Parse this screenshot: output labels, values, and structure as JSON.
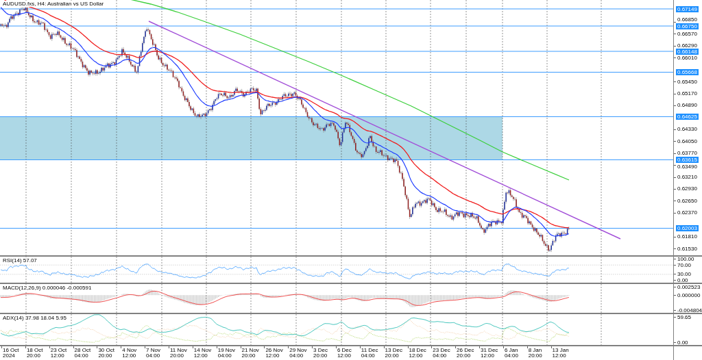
{
  "chart": {
    "title": "AUDUSD.fxs, H4: Australian vs US Dollar",
    "price_ticks": [
      "0.66850",
      "0.66570",
      "0.66290",
      "0.66010",
      "0.65450",
      "0.65170",
      "0.64890",
      "0.64330",
      "0.64050",
      "0.63770",
      "0.63490",
      "0.63210",
      "0.62930",
      "0.62650",
      "0.62370",
      "0.61810",
      "0.61530"
    ],
    "price_levels": [
      "0.67149",
      "0.66750",
      "0.66148",
      "0.65668",
      "0.64625",
      "0.63615",
      "0.62003"
    ]
  },
  "indicators": [
    {
      "kind": "rsi",
      "title": "RSI(14) 57.07",
      "ticks": [
        "100.00",
        "70.00",
        "30.00",
        "0.00"
      ]
    },
    {
      "kind": "macd",
      "title": "MACD(12,26,9) 0.000046 -0.000591",
      "ticks": [
        "0.002523",
        "0.000000",
        "-0.004804"
      ]
    },
    {
      "kind": "adx",
      "title": "ADX(14) 37.98 18.04 5.95",
      "ticks": [
        "59.65",
        "0.00"
      ]
    }
  ],
  "time_axis": [
    "16 Oct 2024",
    "18 Oct 20:00",
    "23 Oct 12:00",
    "28 Oct 04:00",
    "30 Oct 20:00",
    "4 Nov 12:00",
    "7 Nov 04:00",
    "11 Nov 20:00",
    "14 Nov 12:00",
    "19 Nov 04:00",
    "21 Nov 20:00",
    "26 Nov 12:00",
    "29 Nov 04:00",
    "3 Dec 20:00",
    "6 Dec 12:00",
    "11 Dec 04:00",
    "13 Dec 20:00",
    "18 Dec 12:00",
    "23 Dec 04:00",
    "26 Dec 20:00",
    "31 Dec 12:00",
    "6 Jan 04:00",
    "8 Jan 20:00",
    "13 Jan 12:00"
  ]
}
